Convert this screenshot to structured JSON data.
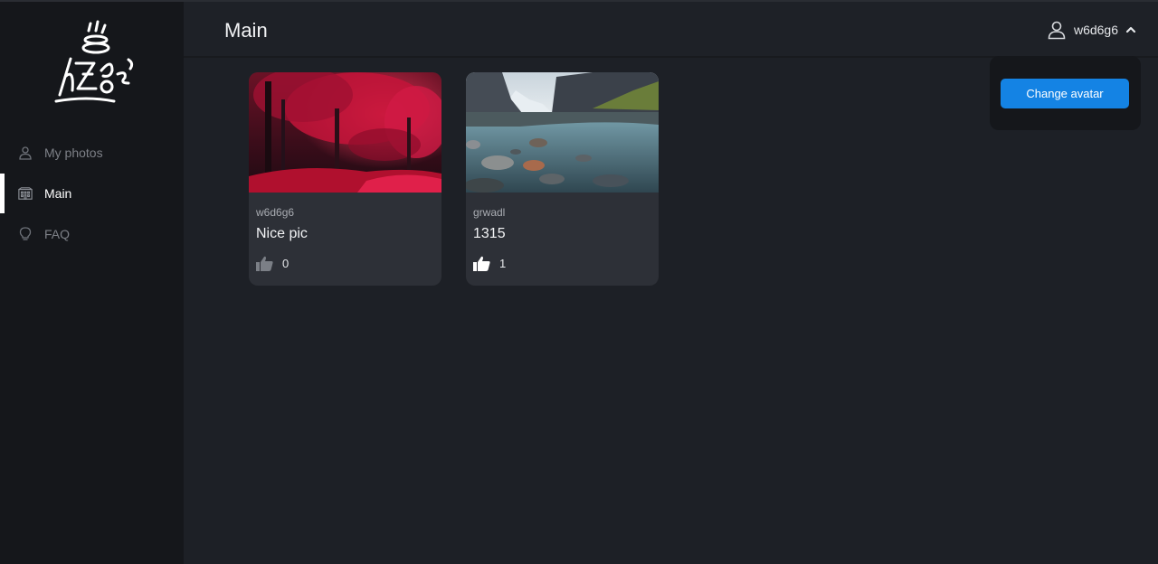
{
  "sidebar": {
    "items": [
      {
        "label": "My photos",
        "icon": "user-icon",
        "active": false
      },
      {
        "label": "Main",
        "icon": "building-icon",
        "active": true
      },
      {
        "label": "FAQ",
        "icon": "lightbulb-icon",
        "active": false
      }
    ]
  },
  "header": {
    "title": "Main",
    "username": "w6d6g6"
  },
  "dropdown": {
    "change_avatar_label": "Change avatar"
  },
  "posts": [
    {
      "author": "w6d6g6",
      "title": "Nice pic",
      "likes": "0",
      "liked": false,
      "image": "red-forest-image"
    },
    {
      "author": "grwadl",
      "title": "1315",
      "likes": "1",
      "liked": true,
      "image": "mountain-river-image"
    }
  ],
  "colors": {
    "accent": "#1483e4",
    "background": "#1d2026",
    "sidebar": "#15171b",
    "card": "#2d3037"
  }
}
